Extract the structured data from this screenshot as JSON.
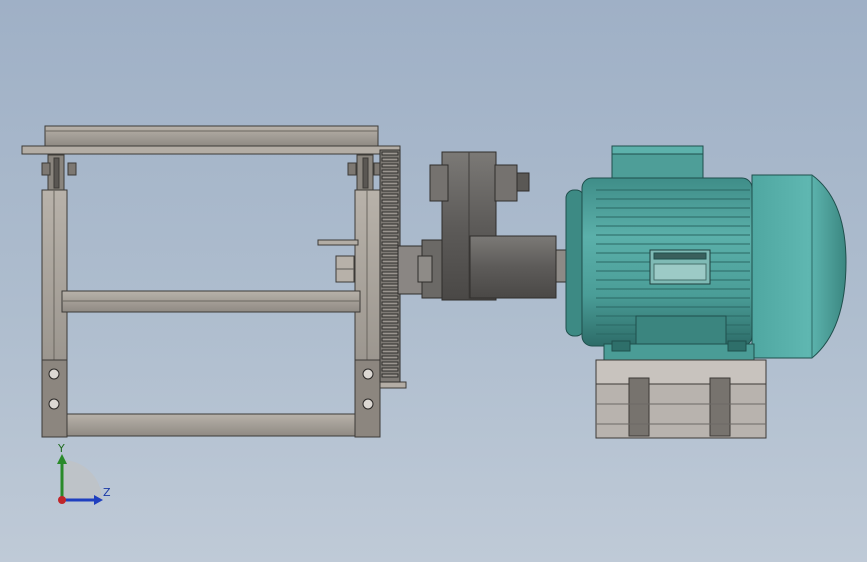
{
  "viewport": {
    "background_top": "#9fb0c6",
    "background_bottom": "#bfcad7"
  },
  "model": {
    "frame_color": "#a39d95",
    "frame_edge": "#3c3a37",
    "gearbox_color": "#6e6c69",
    "motor_color": "#56a8a2",
    "motor_dark": "#2f6f6b",
    "base_color": "#b8b3ae"
  },
  "triad": {
    "y_label": "Y",
    "z_label": "Z",
    "y_color": "#2a8a2a",
    "z_color": "#1f3fbf",
    "origin_color": "#c0262a"
  }
}
